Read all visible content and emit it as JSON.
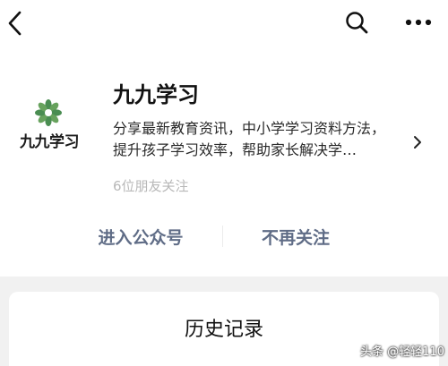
{
  "icons": {
    "back": "chevron-left-icon",
    "search": "search-icon",
    "more": "more-icon",
    "chevron_right": "chevron-right-icon",
    "logo": "flower-logo-icon"
  },
  "account": {
    "logo_text": "九九学习",
    "name": "九九学习",
    "description_lines": [
      "分享最新教育资讯，中小学学习资料方法，",
      "提升孩子学习效率，帮助家长解决学…"
    ],
    "friends_followed": "6位朋友关注"
  },
  "actions": {
    "enter_label": "进入公众号",
    "unfollow_label": "不再关注"
  },
  "history": {
    "title": "历史记录"
  },
  "watermark": {
    "text": "头条 @轻轻110"
  },
  "colors": {
    "action_text": "#5f6c86",
    "logo_green": "#4a8d52",
    "background_gray": "#f1f1f1"
  }
}
